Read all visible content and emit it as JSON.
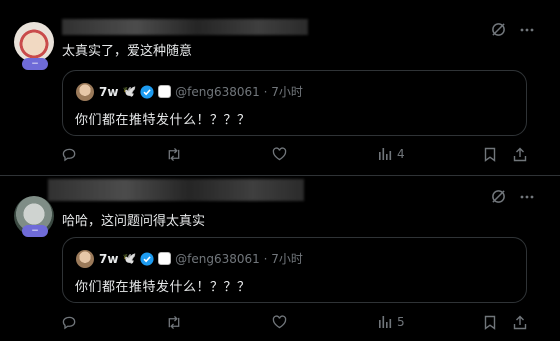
{
  "posts": [
    {
      "avatar_badge": "−",
      "text": "太真实了，爱这种随意",
      "quote": {
        "name": "7w",
        "emoji": "🕊️",
        "handle": "@feng638061 · 7小时",
        "text": "你们都在推特发什么！？？？"
      },
      "views": "4"
    },
    {
      "avatar_badge": "−",
      "text": "哈哈，这问题问得太真实",
      "quote": {
        "name": "7w",
        "emoji": "🕊️",
        "handle": "@feng638061 · 7小时",
        "text": "你们都在推特发什么！？？？"
      },
      "views": "5"
    }
  ],
  "colors": {
    "background": "#000000",
    "muted": "#71767b",
    "text": "#e7e9ea",
    "verified_blue": "#1d9bf0",
    "badge": "#6f6bd8"
  }
}
